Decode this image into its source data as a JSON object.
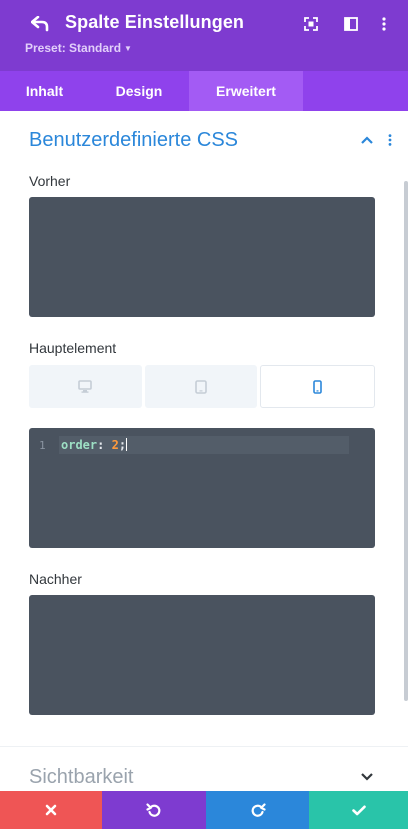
{
  "header": {
    "title": "Spalte Einstellungen",
    "preset_label": "Preset: Standard",
    "background": "#7e3bd0"
  },
  "tabs": [
    {
      "label": "Inhalt",
      "active": false
    },
    {
      "label": "Design",
      "active": false
    },
    {
      "label": "Erweitert",
      "active": true
    }
  ],
  "section": {
    "title": "Benutzerdefinierte CSS",
    "fields": {
      "before_label": "Vorher",
      "before_value": "",
      "main_label": "Hauptelement",
      "after_label": "Nachher",
      "after_value": ""
    },
    "devices": [
      {
        "name": "desktop-icon",
        "active": false
      },
      {
        "name": "tablet-icon",
        "active": false
      },
      {
        "name": "phone-icon",
        "active": true
      }
    ],
    "code": {
      "line_number": "1",
      "property": "order",
      "colon": ": ",
      "value": "2",
      "semicolon": ";"
    }
  },
  "section2": {
    "title": "Sichtbarkeit"
  },
  "footer": {
    "buttons": [
      {
        "name": "close-icon",
        "color": "#ef5555"
      },
      {
        "name": "undo-icon",
        "color": "#7e3bd0"
      },
      {
        "name": "redo-icon",
        "color": "#2b87da"
      },
      {
        "name": "check-icon",
        "color": "#29c4a9"
      }
    ]
  },
  "colors": {
    "accent_purple": "#8f42ec",
    "active_tab": "#a35bf4",
    "link_blue": "#2b87da",
    "editor_bg": "#4a535f"
  }
}
